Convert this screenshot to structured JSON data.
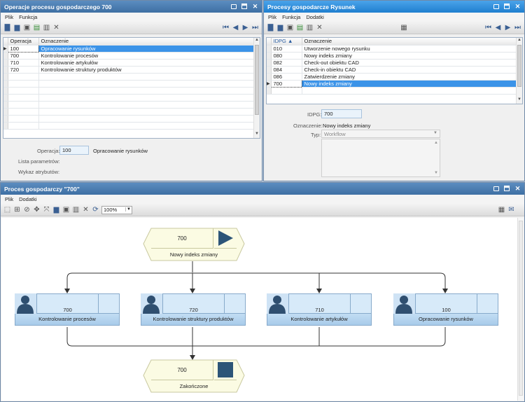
{
  "colors": {
    "titlebar": "#3e6fa3",
    "titlebar_active": "#1f7fcf",
    "selection": "#3b93e8",
    "task_fill": "#d7eaf9",
    "event_fill": "#fbfbe3",
    "event_play": "#2d5578"
  },
  "panel1": {
    "title": "Operacje procesu gospodarczego 700",
    "menu": [
      "Plik",
      "Funkcja"
    ],
    "toolbar_icons": [
      "new-icon",
      "open-icon",
      "save-icon",
      "copy-icon",
      "delete-icon",
      "cancel-icon",
      "first-icon",
      "prev-icon",
      "next-icon",
      "last-icon"
    ],
    "grid": {
      "columns": [
        "Operacja",
        "Oznaczenie"
      ],
      "rows": [
        {
          "code": "100",
          "name": "Opracowanie rysunków"
        },
        {
          "code": "700",
          "name": "Kontrolowanie procesów"
        },
        {
          "code": "710",
          "name": "Kontrolowanie artykułów"
        },
        {
          "code": "720",
          "name": "Kontrolowanie struktury produktów"
        }
      ]
    },
    "form": {
      "operacja_label": "Operacja:",
      "operacja_value": "100",
      "operacja_name": "Opracowanie rysunków",
      "lista_label": "Lista parametrów:",
      "wykaz_label": "Wykaz atrybutów:"
    }
  },
  "panel2": {
    "title": "Procesy gospodarcze Rysunek",
    "menu": [
      "Plik",
      "Funkcja",
      "Dodatki"
    ],
    "grid": {
      "columns": [
        "IDPG",
        "Oznaczenie"
      ],
      "sort_icon": "sort-asc-icon",
      "rows": [
        {
          "code": "010",
          "name": "Utworzenie nowego rysunku"
        },
        {
          "code": "080",
          "name": "Nowy indeks zmiany"
        },
        {
          "code": "082",
          "name": "Check-out obiektu CAD"
        },
        {
          "code": "084",
          "name": "Check-in obiektu CAD"
        },
        {
          "code": "086",
          "name": "Zatwierdzenie zmiany"
        },
        {
          "code": "700",
          "name": "Nowy indeks zmiany"
        }
      ]
    },
    "form": {
      "idpg_label": "IDPG:",
      "idpg_value": "700",
      "oznaczenie_label": "Oznaczenie:",
      "oznaczenie_value": "Nowy indeks zmiany",
      "typ_label": "Typ:",
      "typ_value": "Workflow"
    }
  },
  "panel3": {
    "title": "Proces gospodarczy \"700\"",
    "menu": [
      "Plik",
      "Dodatki"
    ],
    "zoom": "100%",
    "diagram": {
      "start": {
        "id": "700",
        "label": "Nowy indeks zmiany"
      },
      "tasks": [
        {
          "id": "700",
          "label": "Kontrolowanie procesów"
        },
        {
          "id": "720",
          "label": "Kontrolowanie struktury produktów"
        },
        {
          "id": "710",
          "label": "Kontrolowanie artykułów"
        },
        {
          "id": "100",
          "label": "Opracowanie rysunków"
        }
      ],
      "end": {
        "id": "700",
        "label": "Zakończone"
      }
    }
  }
}
